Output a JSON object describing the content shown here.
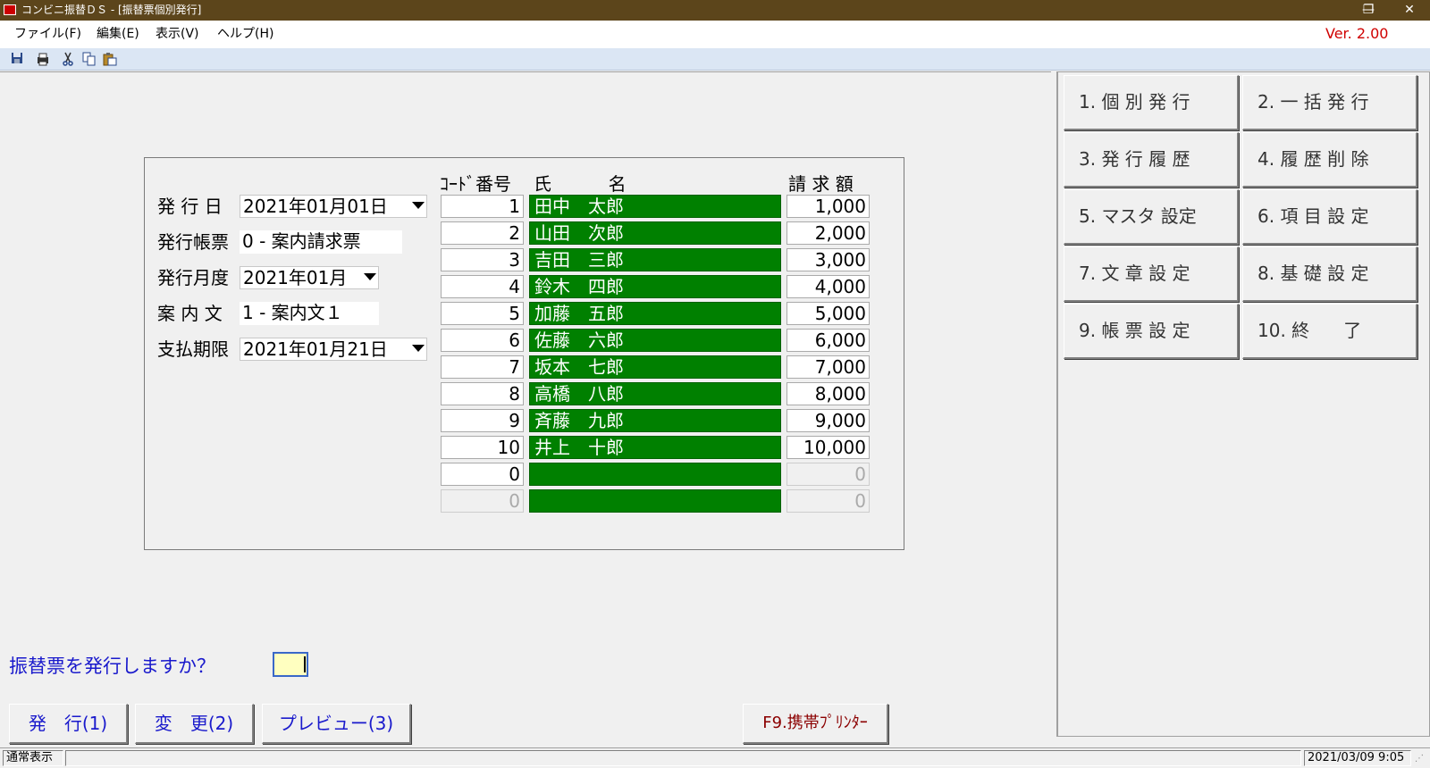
{
  "window": {
    "title": "コンビニ振替ＤＳ - [振替票個別発行]",
    "minimize_glyph": "—",
    "restore_glyph": "❐",
    "close_glyph": "✕"
  },
  "menu": {
    "items": [
      "ファイル(F)",
      "編集(E)",
      "表示(V)",
      "ヘルプ(H)"
    ],
    "version": "Ver. 2.00"
  },
  "toolbar": {
    "icons": [
      "save-icon",
      "print-icon",
      "cut-icon",
      "copy-icon",
      "paste-icon"
    ]
  },
  "form": {
    "issue_date_label": "発 行 日",
    "issue_date_value": "2021年01月01日",
    "form_type_label": "発行帳票",
    "form_type_value": "0 - 案内請求票",
    "month_label": "発行月度",
    "month_value": "2021年01月",
    "notice_label": "案 内 文",
    "notice_value": "1 - 案内文１",
    "due_label": "支払期限",
    "due_value": "2021年01月21日"
  },
  "table": {
    "header_code": "ｺｰﾄﾞ番号",
    "header_name": "氏          名",
    "header_amount": "請 求 額",
    "rows": [
      {
        "code": "1",
        "name": "田中　太郎",
        "amount": "1,000"
      },
      {
        "code": "2",
        "name": "山田　次郎",
        "amount": "2,000"
      },
      {
        "code": "3",
        "name": "吉田　三郎",
        "amount": "3,000"
      },
      {
        "code": "4",
        "name": "鈴木　四郎",
        "amount": "4,000"
      },
      {
        "code": "5",
        "name": "加藤　五郎",
        "amount": "5,000"
      },
      {
        "code": "6",
        "name": "佐藤　六郎",
        "amount": "6,000"
      },
      {
        "code": "7",
        "name": "坂本　七郎",
        "amount": "7,000"
      },
      {
        "code": "8",
        "name": "高橋　八郎",
        "amount": "8,000"
      },
      {
        "code": "9",
        "name": "斉藤　九郎",
        "amount": "9,000"
      },
      {
        "code": "10",
        "name": "井上　十郎",
        "amount": "10,000"
      },
      {
        "code": "0",
        "name": "",
        "amount": "0"
      },
      {
        "code": "0",
        "name": "",
        "amount": "0"
      }
    ]
  },
  "prompt": {
    "question": "振替票を発行しますか？",
    "answer": ""
  },
  "buttons": {
    "issue": "発　行(1)",
    "change": "変　更(2)",
    "preview": "プレビュー(3)",
    "mobile_printer": "F9.携帯ﾌﾟﾘﾝﾀｰ"
  },
  "side_menu": [
    "1. 個 別 発 行",
    "2. 一 括 発 行",
    "3. 発 行 履 歴",
    "4. 履 歴 削 除",
    "5. マスタ 設定",
    "6. 項 目 設 定",
    "7. 文 章 設 定",
    "8. 基 礎 設 定",
    "9. 帳 票 設 定",
    "10. 終      了"
  ],
  "status": {
    "mode": "通常表示",
    "datetime": "2021/03/09 9:05"
  },
  "colors": {
    "titlebar": "#5c451b",
    "name_cell": "#008000",
    "prompt_text": "#1a1acc",
    "version_text": "#d00000"
  }
}
